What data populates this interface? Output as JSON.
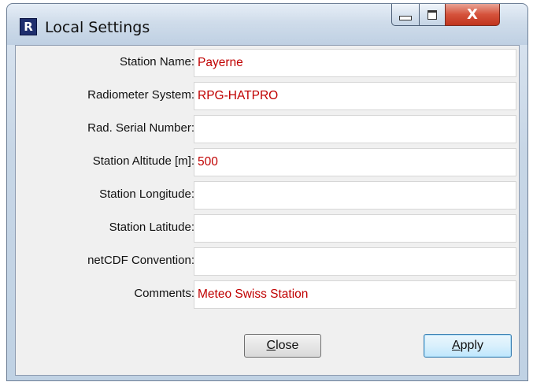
{
  "window": {
    "title": "Local Settings",
    "app_icon_glyph": "R",
    "controls": {
      "minimize": "minimize-icon",
      "maximize": "maximize-icon",
      "close_glyph": "X"
    }
  },
  "form": {
    "fields": [
      {
        "label": "Station Name:",
        "value": "Payerne"
      },
      {
        "label": "Radiometer System:",
        "value": "RPG-HATPRO"
      },
      {
        "label": "Rad. Serial Number:",
        "value": ""
      },
      {
        "label": "Station Altitude [m]:",
        "value": "500"
      },
      {
        "label": "Station Longitude:",
        "value": ""
      },
      {
        "label": "Station Latitude:",
        "value": ""
      },
      {
        "label": "netCDF Convention:",
        "value": ""
      },
      {
        "label": "Comments:",
        "value": "Meteo Swiss Station"
      }
    ]
  },
  "buttons": {
    "close": {
      "mnemonic": "C",
      "rest": "lose"
    },
    "apply": {
      "mnemonic": "A",
      "rest": "pply"
    }
  },
  "colors": {
    "value_text": "#c00000",
    "title_close": "#c0341d"
  }
}
